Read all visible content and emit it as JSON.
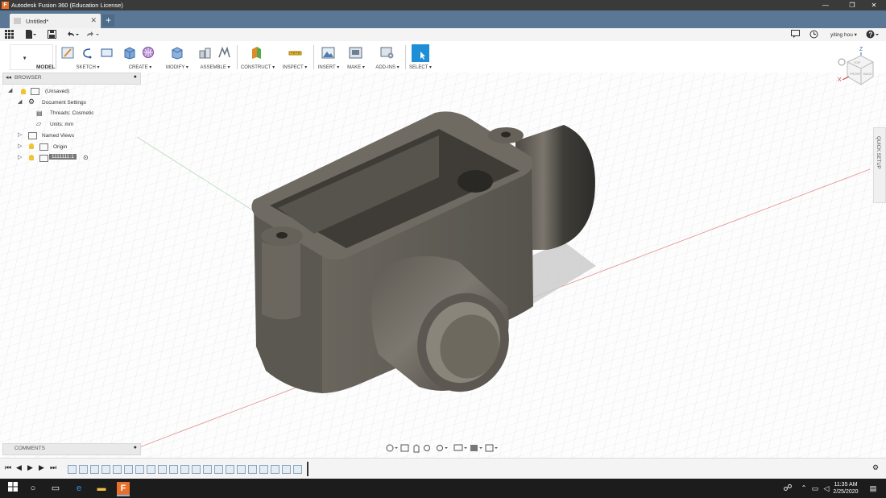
{
  "window": {
    "title": "Autodesk Fusion 360 (Education License)",
    "logo_letter": "F"
  },
  "tab": {
    "label": "Untitled*"
  },
  "user": {
    "name": "yiting hou"
  },
  "toolbar": {
    "workspace": "MODEL",
    "groups": [
      "SKETCH",
      "CREATE",
      "MODIFY",
      "ASSEMBLE",
      "CONSTRUCT",
      "INSPECT",
      "INSERT",
      "MAKE",
      "ADD-INS",
      "SELECT"
    ]
  },
  "browser": {
    "title": "BROWSER",
    "root": "(Unsaved)",
    "document_settings": "Document Settings",
    "threads": "Threads: Cosmetic",
    "units": "Units: mm",
    "named_views": "Named Views",
    "origin": "Origin",
    "component": "1111111:1"
  },
  "viewcube": {
    "top": "TOP",
    "front": "FRONT",
    "back": "BACK",
    "z": "Z",
    "x": "X"
  },
  "quick_setup": "QUICK SETUP",
  "comments": {
    "title": "COMMENTS"
  },
  "taskbar": {
    "time": "11:35 AM",
    "date": "2/25/2020"
  }
}
